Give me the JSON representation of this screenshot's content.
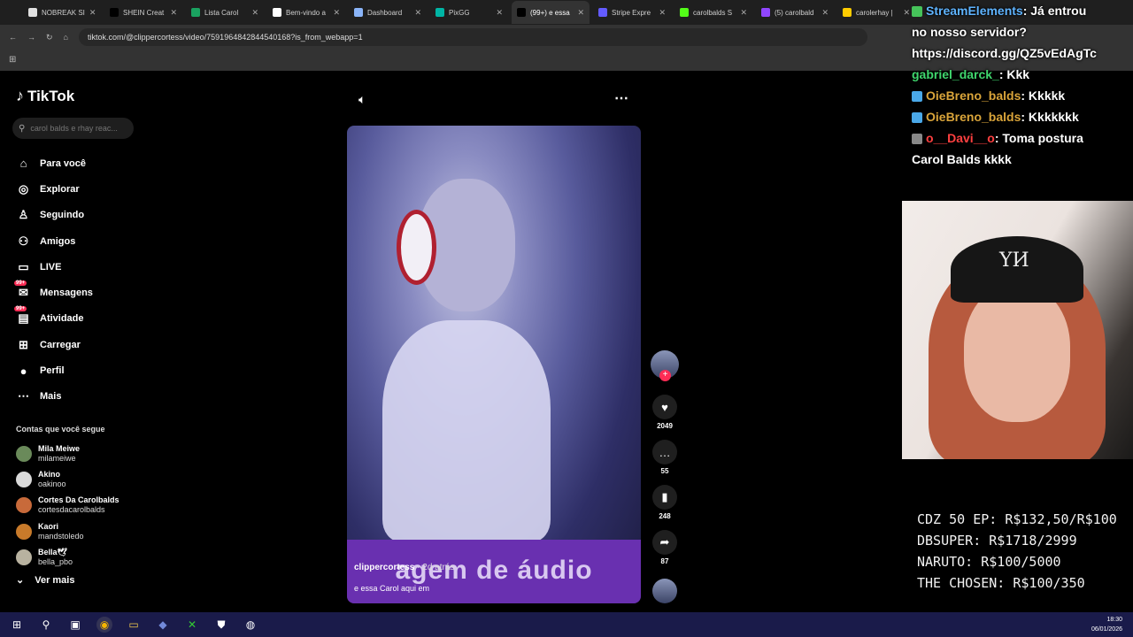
{
  "browser": {
    "tabs": [
      {
        "label": "NOBREAK SI",
        "color": "#e0e0e0"
      },
      {
        "label": "SHEIN Creat",
        "color": "#000000"
      },
      {
        "label": "Lista Carol",
        "color": "#1aa260"
      },
      {
        "label": "Bem-vindo a",
        "color": "#ffffff"
      },
      {
        "label": "Dashboard",
        "color": "#8ab4f8"
      },
      {
        "label": "PixGG",
        "color": "#00b5a5"
      },
      {
        "label": "(99+) e essa",
        "color": "#000000"
      },
      {
        "label": "Stripe Expre",
        "color": "#635bff"
      },
      {
        "label": "carolbalds S",
        "color": "#53fc18"
      },
      {
        "label": "(5) carolbald",
        "color": "#9146ff"
      },
      {
        "label": "carolerhay |",
        "color": "#ffcc00"
      }
    ],
    "url": "tiktok.com/@clippercortess/video/7591964842844540168?is_from_webapp=1"
  },
  "sidebar": {
    "logo": "TikTok",
    "search_placeholder": "carol balds e rhay reac...",
    "nav": [
      {
        "label": "Para você",
        "icon": "home-icon",
        "glyph": "⌂"
      },
      {
        "label": "Explorar",
        "icon": "compass-icon",
        "glyph": "◎"
      },
      {
        "label": "Seguindo",
        "icon": "following-icon",
        "glyph": "♙"
      },
      {
        "label": "Amigos",
        "icon": "friends-icon",
        "glyph": "⚇"
      },
      {
        "label": "LIVE",
        "icon": "live-icon",
        "glyph": "▭"
      },
      {
        "label": "Mensagens",
        "icon": "messages-icon",
        "glyph": "✉",
        "badge": "99+"
      },
      {
        "label": "Atividade",
        "icon": "activity-icon",
        "glyph": "▤",
        "badge": "99+"
      },
      {
        "label": "Carregar",
        "icon": "upload-icon",
        "glyph": "⊞"
      },
      {
        "label": "Perfil",
        "icon": "profile-icon",
        "glyph": "●"
      },
      {
        "label": "Mais",
        "icon": "more-icon",
        "glyph": "⋯"
      }
    ],
    "following_title": "Contas que você segue",
    "accounts": [
      {
        "name": "Mila Meiwe",
        "handle": "milameiwe",
        "color": "#6a8a5a"
      },
      {
        "name": "Akino",
        "handle": "oakinoo",
        "color": "#d9d9d9"
      },
      {
        "name": "Cortes Da Carolbalds",
        "handle": "cortesdacarolbalds",
        "color": "#c86a3a"
      },
      {
        "name": "Kaori",
        "handle": "mandstoledo",
        "color": "#c87a2a"
      },
      {
        "name": "Bella🕊",
        "handle": "bella_pbo",
        "color": "#b8b2a0"
      }
    ],
    "see_more": "Ver mais"
  },
  "video": {
    "overlay_caption": "agem de áudio",
    "author": "clippercortess",
    "time": "· 2d atrás",
    "description": "e essa Carol aqui em"
  },
  "actions": {
    "likes": "2049",
    "comments": "55",
    "saves": "248",
    "shares": "87"
  },
  "stream": {
    "chat": [
      {
        "user": "StreamElements",
        "text": ": Já entrou",
        "user_color": "#5fb4ff",
        "icon_color": "#46c35a"
      },
      {
        "user": "",
        "text": "no nosso servidor?",
        "user_color": "#ffffff",
        "icon_color": ""
      },
      {
        "user": "",
        "text": "https://discord.gg/QZ5vEdAgTc",
        "user_color": "#ffffff",
        "icon_color": ""
      },
      {
        "user": "gabriel_darck_",
        "text": ": Kkk",
        "user_color": "#3fd66d",
        "icon_color": ""
      },
      {
        "user": "OieBreno_balds",
        "text": ": Kkkkk",
        "user_color": "#d9a43a",
        "icon_color": "#4aa8e8"
      },
      {
        "user": "OieBreno_balds",
        "text": ": Kkkkkkk",
        "user_color": "#d9a43a",
        "icon_color": "#4aa8e8"
      },
      {
        "user": "o__Davi__o",
        "text": ": Toma postura",
        "user_color": "#ff4040",
        "icon_color": "#888888"
      },
      {
        "user": "",
        "text": "Carol Balds kkkk",
        "user_color": "#ffffff",
        "icon_color": ""
      }
    ],
    "webcam_cap_text": "YИ",
    "goals": [
      "CDZ 50 EP: R$132,50/R$100",
      "DBSUPER: R$1718/2999",
      "NARUTO: R$100/5000",
      "THE CHOSEN: R$100/350"
    ]
  },
  "taskbar": {
    "time": "18:30",
    "date": "06/01/2026"
  }
}
